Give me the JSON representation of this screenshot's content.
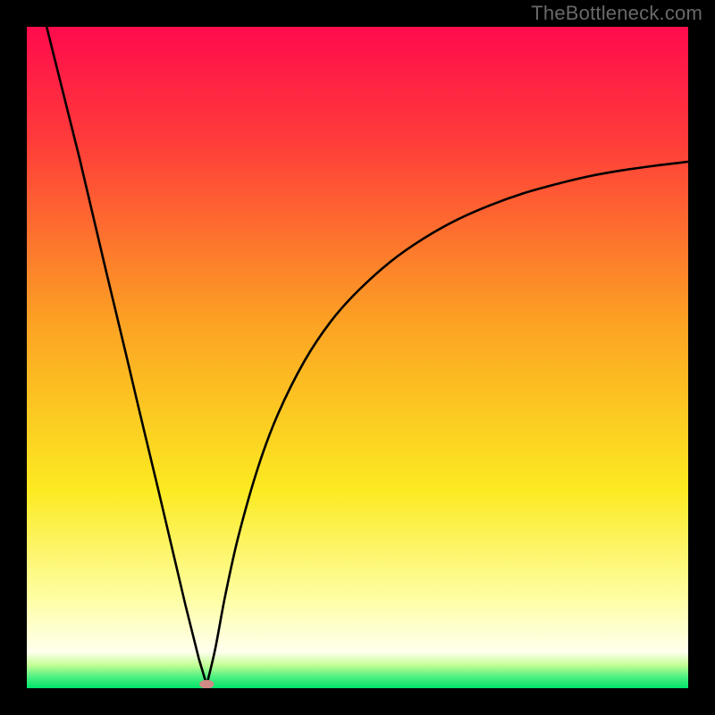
{
  "watermark": "TheBottleneck.com",
  "chart_data": {
    "type": "line",
    "title": "",
    "xlabel": "",
    "ylabel": "",
    "xlim": [
      0,
      100
    ],
    "ylim": [
      0,
      100
    ],
    "grid": false,
    "background": {
      "gradient_stops": [
        {
          "offset": 0.0,
          "color": "#ff0b4d"
        },
        {
          "offset": 0.17,
          "color": "#ff3b3a"
        },
        {
          "offset": 0.45,
          "color": "#fca323"
        },
        {
          "offset": 0.7,
          "color": "#fcea21"
        },
        {
          "offset": 0.87,
          "color": "#feffa8"
        },
        {
          "offset": 0.945,
          "color": "#ffffee"
        },
        {
          "offset": 0.965,
          "color": "#c4ff95"
        },
        {
          "offset": 0.983,
          "color": "#4df082"
        },
        {
          "offset": 1.0,
          "color": "#00e46a"
        }
      ]
    },
    "series": [
      {
        "name": "left-branch",
        "x": [
          3,
          5,
          8,
          10,
          12,
          15,
          17,
          20,
          22,
          24,
          26,
          27.2
        ],
        "y": [
          100,
          92,
          80,
          71.5,
          63,
          50.5,
          42,
          29.5,
          21,
          12.5,
          4.5,
          0.5
        ]
      },
      {
        "name": "right-branch",
        "x": [
          27.2,
          28.5,
          30,
          32,
          35,
          38,
          42,
          46,
          50,
          55,
          60,
          65,
          70,
          75,
          80,
          85,
          90,
          95,
          100
        ],
        "y": [
          0.5,
          6,
          14,
          23,
          33.5,
          41.5,
          49.5,
          55.5,
          60,
          64.5,
          68,
          70.8,
          73,
          74.8,
          76.2,
          77.4,
          78.3,
          79,
          79.6
        ]
      }
    ],
    "marker": {
      "name": "minimum-marker",
      "x": 27.2,
      "y": 0.6,
      "rx": 1.1,
      "ry": 0.65,
      "fill": "#d18b86"
    }
  },
  "colors": {
    "frame": "#000000",
    "curve": "#000000",
    "watermark": "#686868"
  }
}
